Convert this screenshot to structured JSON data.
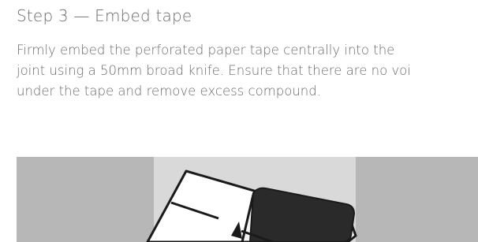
{
  "step": {
    "title": "Step 3 — Embed tape",
    "description_lines": [
      "Firmly embed the perforated paper tape centrally into the",
      "joint using a 50mm broad knife. Ensure that there are no voi",
      "under the tape and remove excess compound."
    ]
  },
  "illustration": {
    "subject": "broad-knife-on-tape",
    "colors": {
      "background": "#b7b7b7",
      "panel": "#d9d9d9",
      "blade": "#ffffff",
      "outline": "#1a1a1a",
      "handle": "#2a2a2a"
    }
  }
}
